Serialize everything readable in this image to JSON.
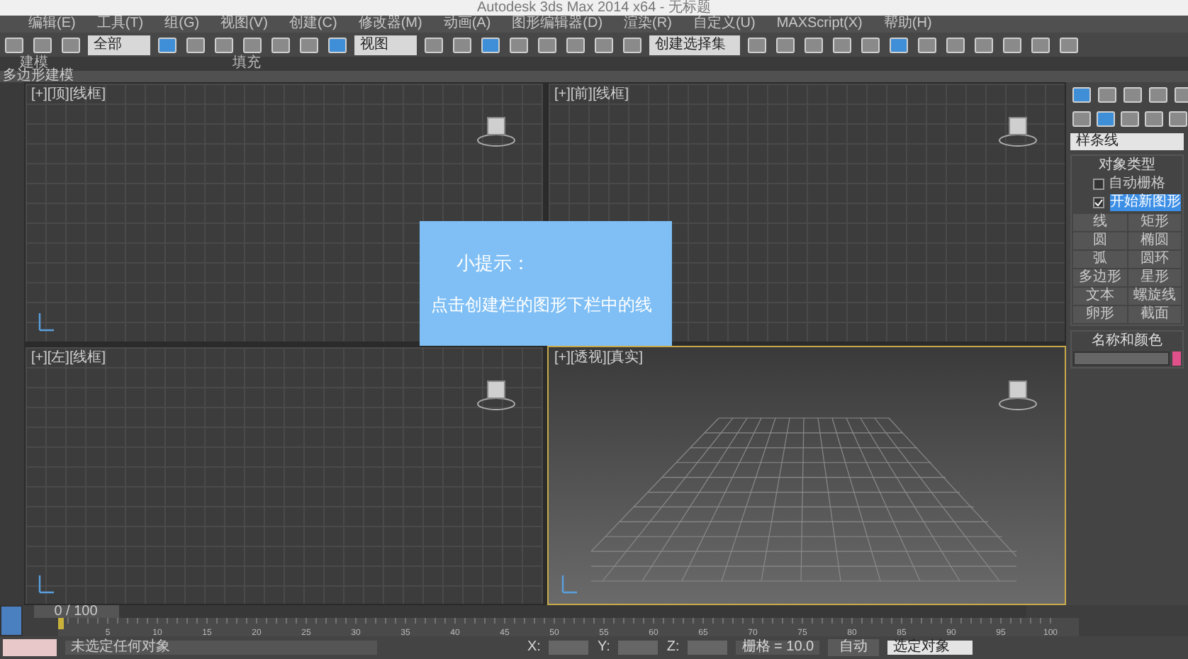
{
  "window": {
    "title": "Autodesk 3ds Max 2014 x64 - 无标题"
  },
  "menu": [
    "编辑(E)",
    "工具(T)",
    "组(G)",
    "视图(V)",
    "创建(C)",
    "修改器(M)",
    "动画(A)",
    "图形编辑器(D)",
    "渲染(R)",
    "自定义(U)",
    "MAXScript(X)",
    "帮助(H)"
  ],
  "toolbar": {
    "selection_filter": "全部",
    "reference_coord": "视图",
    "named_selection": "创建选择集"
  },
  "ribbon": {
    "tabs": [
      "建模",
      "填充"
    ],
    "panel": "多边形建模"
  },
  "viewports": [
    {
      "label": "[+][顶][线框]",
      "kind": "ortho",
      "active": false
    },
    {
      "label": "[+][前][线框]",
      "kind": "ortho",
      "active": false
    },
    {
      "label": "[+][左][线框]",
      "kind": "ortho",
      "active": false
    },
    {
      "label": "[+][透视][真实]",
      "kind": "perspective",
      "active": true
    }
  ],
  "tip": {
    "title": "小提示：",
    "text": "点击创建栏的图形下栏中的线"
  },
  "command_panel": {
    "category": "样条线",
    "rollout": "对象类型",
    "auto_grid": {
      "label": "自动栅格",
      "checked": false
    },
    "start_new": {
      "label": "开始新图形",
      "checked": true
    },
    "buttons": [
      "线",
      "矩形",
      "圆",
      "椭圆",
      "弧",
      "圆环",
      "多边形",
      "星形",
      "文本",
      "螺旋线",
      "卵形",
      "截面"
    ],
    "name_rollout": "名称和颜色",
    "color": "#e0508a"
  },
  "timeline": {
    "frame": "0 / 100",
    "level": 0,
    "labels": [
      "5",
      "10",
      "15",
      "20",
      "25",
      "30",
      "35",
      "40",
      "45",
      "50",
      "55",
      "60",
      "65",
      "70",
      "75",
      "80",
      "85",
      "90",
      "95",
      "100"
    ]
  },
  "status": {
    "message": "未选定任何对象",
    "x_label": "X:",
    "y_label": "Y:",
    "z_label": "Z:",
    "grid": "栅格 = 10.0",
    "auto_key": "自动",
    "key_filter": "选定对象"
  }
}
